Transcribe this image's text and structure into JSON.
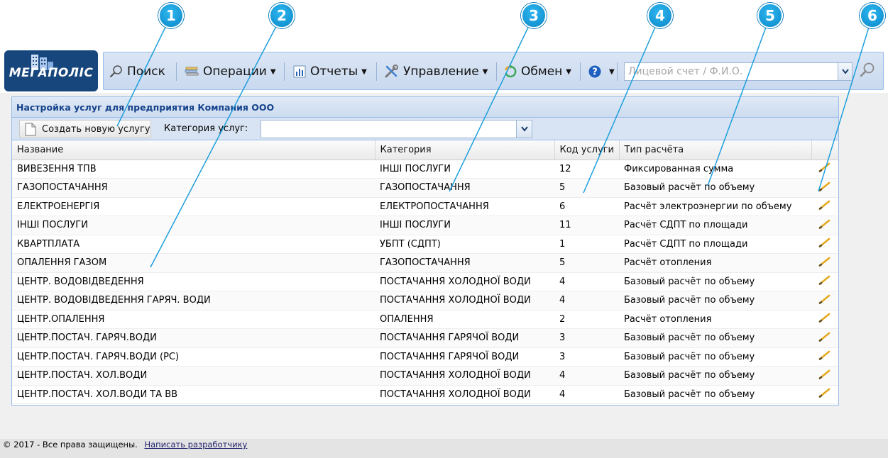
{
  "app": {
    "logo_text": "МЕГАПОЛІС",
    "toolbar": {
      "search_label": "Поиск",
      "operations_label": "Операции",
      "reports_label": "Отчеты",
      "management_label": "Управление",
      "exchange_label": "Обмен",
      "account_search_placeholder": "Лицевой счет / Ф.И.О."
    }
  },
  "panel": {
    "title": "Настройка услуг для предприятия Компания ООО",
    "create_button_label": "Создать новую услугу",
    "category_label": "Категория услуг:",
    "category_value": ""
  },
  "table": {
    "columns": [
      "Название",
      "Категория",
      "Код услуги",
      "Тип расчёта",
      ""
    ],
    "rows": [
      [
        "ВИВЕЗЕННЯ ТПВ",
        "ІНШІ ПОСЛУГИ",
        "12",
        "Фиксированная сумма"
      ],
      [
        "ГАЗОПОСТАЧАННЯ",
        "ГАЗОПОСТАЧАННЯ",
        "5",
        "Базовый расчёт по объему"
      ],
      [
        "ЕЛЕКТРОЕНЕРГІЯ",
        "ЕЛЕКТРОПОСТАЧАННЯ",
        "6",
        "Расчёт электроэнергии по объему"
      ],
      [
        "ІНШІ ПОСЛУГИ",
        "ІНШІ ПОСЛУГИ",
        "11",
        "Расчёт СДПТ по площади"
      ],
      [
        "КВАРТПЛАТА",
        "УБПТ (СДПТ)",
        "1",
        "Расчёт СДПТ по площади"
      ],
      [
        "ОПАЛЕННЯ ГАЗОМ",
        "ГАЗОПОСТАЧАННЯ",
        "5",
        "Расчёт отопления"
      ],
      [
        "ЦЕНТР. ВОДОВІДВЕДЕННЯ",
        "ПОСТАЧАННЯ ХОЛОДНОЇ ВОДИ",
        "4",
        "Базовый расчёт по объему"
      ],
      [
        "ЦЕНТР. ВОДОВІДВЕДЕННЯ ГАРЯЧ. ВОДИ",
        "ПОСТАЧАННЯ ХОЛОДНОЇ ВОДИ",
        "4",
        "Базовый расчёт по объему"
      ],
      [
        "ЦЕНТР.ОПАЛЕННЯ",
        "ОПАЛЕННЯ",
        "2",
        "Расчёт отопления"
      ],
      [
        "ЦЕНТР.ПОСТАЧ. ГАРЯЧ.ВОДИ",
        "ПОСТАЧАННЯ ГАРЯЧОЇ ВОДИ",
        "3",
        "Базовый расчёт по объему"
      ],
      [
        "ЦЕНТР.ПОСТАЧ. ГАРЯЧ.ВОДИ (РС)",
        "ПОСТАЧАННЯ ГАРЯЧОЇ ВОДИ",
        "3",
        "Базовый расчёт по объему"
      ],
      [
        "ЦЕНТР.ПОСТАЧ. ХОЛ.ВОДИ",
        "ПОСТАЧАННЯ ХОЛОДНОЇ ВОДИ",
        "4",
        "Базовый расчёт по объему"
      ],
      [
        "ЦЕНТР.ПОСТАЧ. ХОЛ.ВОДИ ТА ВВ",
        "ПОСТАЧАННЯ ХОЛОДНОЇ ВОДИ",
        "4",
        "Базовый расчёт по объему"
      ]
    ]
  },
  "annotations": [
    "1",
    "2",
    "3",
    "4",
    "5",
    "6"
  ],
  "footer": {
    "copyright": "© 2017 - Все права защищены.",
    "contact_link": "Написать разработчику"
  },
  "icons": {
    "edit": "pencil-icon",
    "search": "magnifier-icon",
    "operations": "stack-icon",
    "reports": "bar-chart-icon",
    "management": "tools-icon",
    "exchange": "refresh-icon",
    "help": "help-icon"
  },
  "colors": {
    "toolbar_bg": "#c9d9ef",
    "panel_title": "#15428b",
    "callout": "#0a87c8",
    "logo_bg": "#17467d",
    "edit_icon": "#e5a81c"
  }
}
